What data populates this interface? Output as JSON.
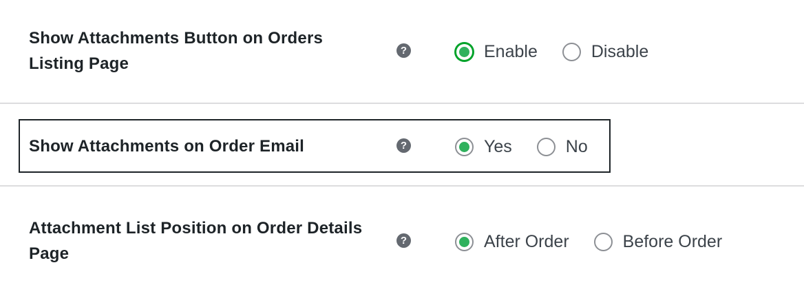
{
  "settings": {
    "rows": [
      {
        "label": "Show Attachments Button on Orders Listing Page",
        "help_symbol": "?",
        "options": [
          {
            "label": "Enable",
            "checked": true
          },
          {
            "label": "Disable",
            "checked": false
          }
        ]
      },
      {
        "label": "Show Attachments on Order Email",
        "help_symbol": "?",
        "options": [
          {
            "label": "Yes",
            "checked": true
          },
          {
            "label": "No",
            "checked": false
          }
        ]
      },
      {
        "label": "Attachment List Position on Order Details Page",
        "help_symbol": "?",
        "options": [
          {
            "label": "After Order",
            "checked": true
          },
          {
            "label": "Before Order",
            "checked": false
          }
        ]
      }
    ]
  },
  "colors": {
    "accent": "#2fb15d",
    "focus_ring": "#00a32a",
    "divider": "#dcdcde",
    "help_icon_bg": "#646970"
  }
}
